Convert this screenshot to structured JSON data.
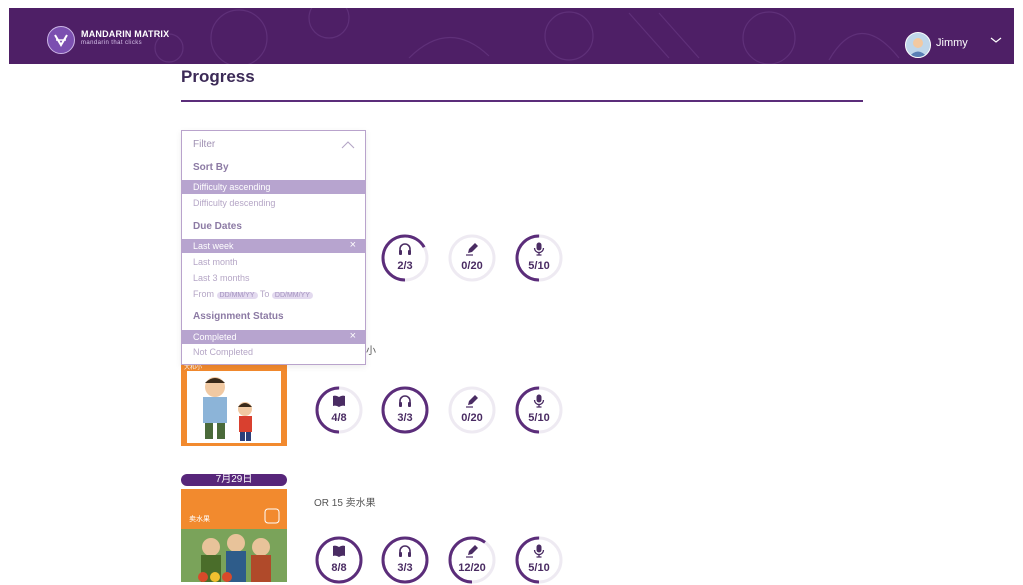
{
  "header": {
    "brand_name": "MANDARIN MATRIX",
    "brand_tagline": "mandarin that clicks",
    "user_name": "Jimmy",
    "color": "#4e1f66"
  },
  "page": {
    "title": "Progress"
  },
  "filter": {
    "label": "Filter",
    "sort_by": {
      "heading": "Sort By",
      "options": [
        "Difficulty ascending",
        "Difficulty descending"
      ],
      "selected": "Difficulty ascending"
    },
    "due_dates": {
      "heading": "Due Dates",
      "selected": "Last week",
      "options": [
        "Last month",
        "Last 3 months"
      ],
      "from_label": "From",
      "from_placeholder": "DD/MM/YY",
      "to_label": "To",
      "to_placeholder": "DD/MM/YY"
    },
    "assignment_status": {
      "heading": "Assignment Status",
      "selected": "Completed",
      "options": [
        "Not Completed"
      ]
    }
  },
  "rows": [
    {
      "stats": [
        {
          "icon": "headphones-icon",
          "value": "2/3",
          "fraction": 0.667
        },
        {
          "icon": "pencil-icon",
          "value": "0/20",
          "fraction": 0
        },
        {
          "icon": "microphone-icon",
          "value": "5/10",
          "fraction": 0.5
        }
      ],
      "hidden_partial_text": "小"
    },
    {
      "thumb_caption": "大和小",
      "stats": [
        {
          "icon": "book-icon",
          "value": "4/8",
          "fraction": 0.5
        },
        {
          "icon": "headphones-icon",
          "value": "3/3",
          "fraction": 1
        },
        {
          "icon": "pencil-icon",
          "value": "0/20",
          "fraction": 0
        },
        {
          "icon": "microphone-icon",
          "value": "5/10",
          "fraction": 0.5
        }
      ]
    },
    {
      "date": "7月29日",
      "title": "OR 15 卖水果",
      "thumb_caption": "卖水果",
      "stats": [
        {
          "icon": "book-icon",
          "value": "8/8",
          "fraction": 1
        },
        {
          "icon": "headphones-icon",
          "value": "3/3",
          "fraction": 1
        },
        {
          "icon": "pencil-icon",
          "value": "12/20",
          "fraction": 0.6
        },
        {
          "icon": "microphone-icon",
          "value": "5/10",
          "fraction": 0.5
        }
      ]
    }
  ]
}
